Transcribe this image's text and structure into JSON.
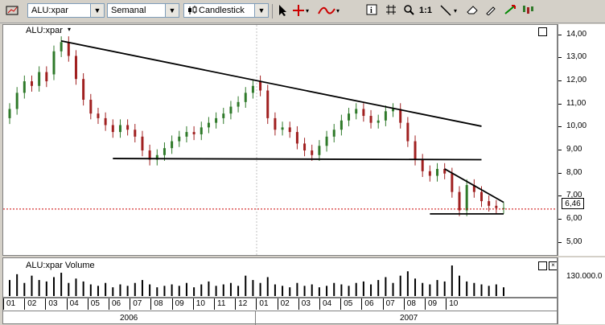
{
  "toolbar": {
    "symbol": "ALU:xpar",
    "period": "Semanal",
    "chart_type": "Candlestick",
    "zoom_label": "1:1",
    "icons": [
      "pointer-icon",
      "crosshair-icon",
      "indicator-icon",
      "info-icon",
      "grid-icon",
      "zoom-icon",
      "trendline-icon",
      "eraser-icon",
      "drawing-icon",
      "delete-icon"
    ]
  },
  "price_pane": {
    "label": "ALU:xpar",
    "current_price": "6,46"
  },
  "volume_pane": {
    "label": "ALU:xpar Volume",
    "tick": "130.000.0"
  },
  "colors": {
    "up": "#2f7a2a",
    "down": "#a02020",
    "trend": "#000000",
    "price_line": "#cc0000"
  },
  "chart_data": [
    {
      "type": "candlestick",
      "title": "ALU:xpar",
      "yticks": [
        "14,00",
        "13,00",
        "12,00",
        "11,00",
        "10,00",
        "9,00",
        "8,00",
        "7,00",
        "6,00",
        "5,00"
      ],
      "ylim": [
        4.5,
        14.2
      ],
      "xlabels": [
        "01",
        "02",
        "03",
        "04",
        "05",
        "06",
        "07",
        "08",
        "09",
        "10",
        "11",
        "12",
        "01",
        "02",
        "03",
        "04",
        "05",
        "06",
        "07",
        "08",
        "09",
        "10"
      ],
      "years": [
        "2006",
        "2007"
      ],
      "current_price": 6.46,
      "close": [
        10.8,
        11.5,
        12.0,
        11.8,
        12.4,
        12.0,
        13.3,
        13.7,
        13.1,
        12.1,
        11.2,
        10.6,
        10.4,
        10.1,
        9.8,
        10.1,
        9.9,
        9.6,
        9.0,
        8.6,
        8.8,
        9.1,
        9.4,
        9.6,
        9.8,
        9.7,
        10.0,
        10.2,
        10.4,
        10.6,
        10.9,
        11.1,
        11.5,
        11.8,
        11.6,
        10.4,
        9.9,
        10.0,
        9.8,
        9.3,
        9.0,
        8.8,
        9.2,
        9.6,
        9.9,
        10.3,
        10.6,
        10.8,
        10.5,
        10.2,
        10.3,
        10.7,
        10.8,
        10.2,
        9.4,
        8.6,
        8.1,
        7.9,
        8.2,
        8.0,
        7.2,
        6.4,
        7.5,
        7.2,
        6.8,
        6.6,
        6.5,
        6.5
      ],
      "open": [
        10.4,
        10.8,
        11.5,
        12.0,
        11.8,
        12.4,
        12.3,
        13.3,
        13.7,
        13.1,
        12.1,
        11.2,
        10.6,
        10.4,
        10.1,
        9.8,
        10.1,
        9.9,
        9.6,
        9.0,
        8.6,
        8.8,
        9.1,
        9.4,
        9.6,
        9.8,
        9.7,
        10.0,
        10.2,
        10.4,
        10.6,
        10.9,
        11.1,
        11.5,
        12.0,
        11.6,
        10.4,
        9.9,
        10.0,
        9.8,
        9.3,
        9.0,
        8.8,
        9.2,
        9.6,
        9.9,
        10.3,
        10.6,
        10.8,
        10.5,
        10.2,
        10.3,
        10.7,
        10.8,
        10.2,
        9.4,
        8.6,
        8.1,
        7.9,
        8.2,
        8.0,
        7.2,
        6.4,
        7.5,
        7.2,
        6.8,
        6.6,
        6.5
      ],
      "volume": [
        22,
        30,
        18,
        28,
        22,
        20,
        26,
        32,
        18,
        24,
        20,
        16,
        14,
        18,
        12,
        16,
        14,
        18,
        22,
        16,
        12,
        14,
        16,
        14,
        18,
        12,
        16,
        20,
        14,
        16,
        18,
        14,
        28,
        22,
        18,
        26,
        16,
        14,
        12,
        18,
        14,
        16,
        12,
        14,
        18,
        16,
        14,
        18,
        20,
        16,
        22,
        26,
        18,
        28,
        34,
        24,
        18,
        16,
        22,
        20,
        42,
        28,
        20,
        18,
        16,
        14,
        16,
        12
      ],
      "trendlines": [
        {
          "from": [
            7,
            13.75
          ],
          "to": [
            64,
            10.05
          ]
        },
        {
          "from": [
            14,
            8.65
          ],
          "to": [
            64,
            8.6
          ]
        },
        {
          "from": [
            59,
            8.2
          ],
          "to": [
            67,
            6.75
          ]
        },
        {
          "from": [
            57,
            6.25
          ],
          "to": [
            67,
            6.25
          ]
        }
      ]
    }
  ]
}
